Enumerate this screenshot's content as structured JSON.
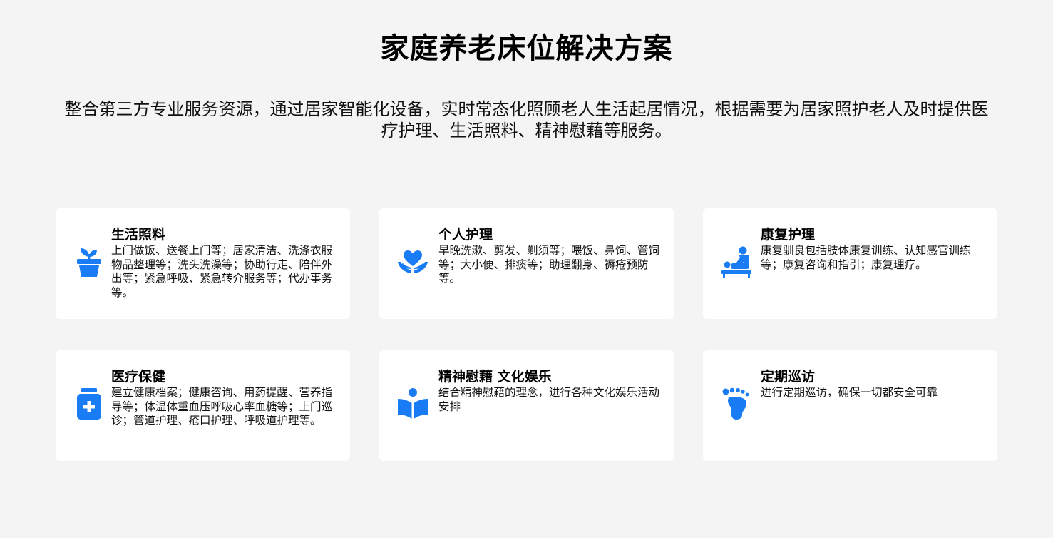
{
  "page": {
    "title": "家庭养老床位解决方案",
    "description": "整合第三方专业服务资源，通过居家智能化设备，实时常态化照顾老人生活起居情况，根据需要为居家照护老人及时提供医疗护理、生活照料、精神慰藉等服务。"
  },
  "theme": {
    "accent": "#1a7cf5",
    "background": "#f4f4f4",
    "card": "#ffffff"
  },
  "services": [
    {
      "icon": "plant-pot-icon",
      "title": "生活照料",
      "text": "上门做饭、送餐上门等；居家清洁、洗涤衣服物品整理等；洗头洗澡等；协助行走、陪伴外出等；紧急呼吸、紧急转介服务等；代办事务等。"
    },
    {
      "icon": "hands-heart-icon",
      "title": "个人护理",
      "text": "早晚洗漱、剪发、剃须等；喂饭、鼻饲、管饲等；大小便、排痰等；助理翻身、褥疮预防等。"
    },
    {
      "icon": "massage-icon",
      "title": "康复护理",
      "text": "康复驯良包括肢体康复训练、认知感官训练等；康复咨询和指引；康复理疗。"
    },
    {
      "icon": "medicine-bottle-icon",
      "title": "医疗保健",
      "text": "建立健康档案；健康咨询、用药提醒、营养指导等；体温体重血压呼吸心率血糖等；上门巡诊；管道护理、疮口护理、呼吸道护理等。"
    },
    {
      "icon": "reading-book-icon",
      "title": "精神慰藉 文化娱乐",
      "text": "结合精神慰藉的理念，进行各种文化娱乐活动安排"
    },
    {
      "icon": "footprint-icon",
      "title": "定期巡访",
      "text": "进行定期巡访，确保一切都安全可靠"
    }
  ]
}
